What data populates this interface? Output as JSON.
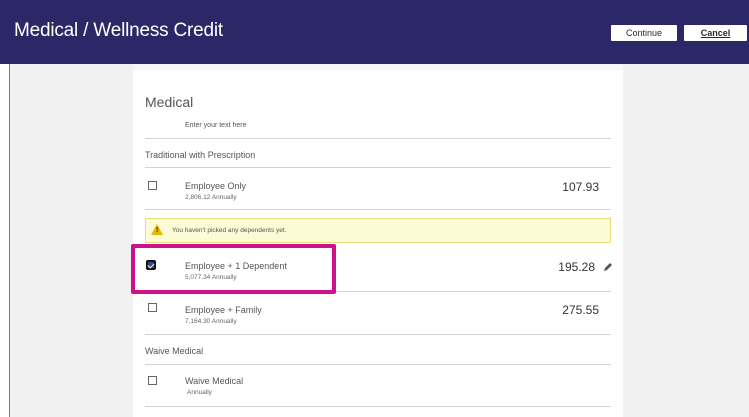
{
  "header": {
    "title": "Medical / Wellness Credit",
    "continue_label": "Continue",
    "cancel_label": "Cancel"
  },
  "panel": {
    "title": "Medical",
    "hint": "Enter your text here",
    "sections": [
      {
        "heading": "Traditional with Prescription",
        "options": [
          {
            "name": "Employee Only",
            "annual": "2,806.12 Annually",
            "price": "107.93",
            "checked": false
          },
          {
            "name": "Employee + 1 Dependent",
            "annual": "5,077.34 Annually",
            "price": "195.28",
            "checked": true
          },
          {
            "name": "Employee + Family",
            "annual": "7,164.30 Annually",
            "price": "275.55",
            "checked": false
          }
        ]
      },
      {
        "heading": "Waive Medical",
        "options": [
          {
            "name": "Waive Medical",
            "annual": "Annually",
            "price": "",
            "checked": false
          }
        ]
      }
    ],
    "warning": "You haven't picked any dependents yet."
  },
  "colors": {
    "header_bg": "#2c2868",
    "highlight": "#cf0f8b",
    "warning_bg": "#fdfbd6"
  }
}
